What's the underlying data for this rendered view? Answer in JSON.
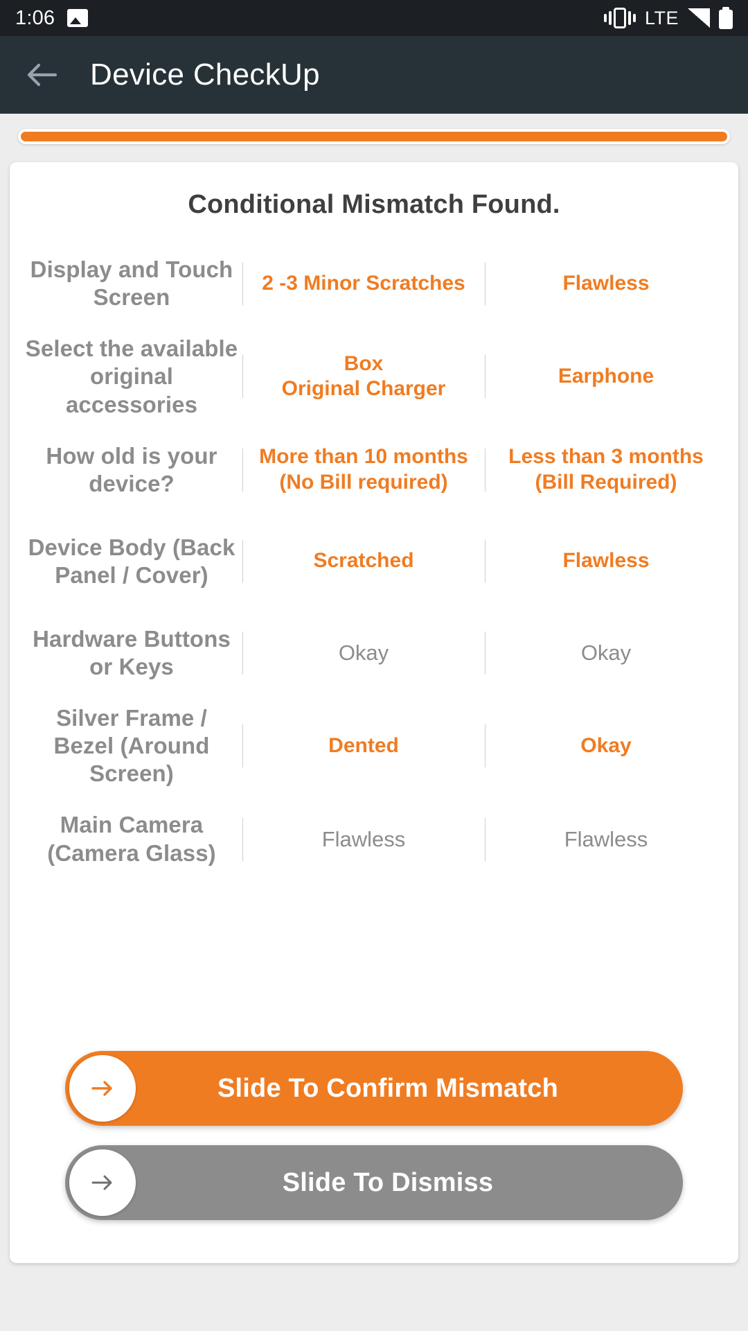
{
  "status_bar": {
    "time": "1:06",
    "network_label": "LTE",
    "icons": [
      "image-icon",
      "vibrate-icon",
      "signal-icon",
      "battery-icon"
    ]
  },
  "app_bar": {
    "back_icon": "back-arrow-icon",
    "title": "Device CheckUp"
  },
  "progress": {
    "percent": 100
  },
  "card": {
    "title": "Conditional Mismatch Found.",
    "colors": {
      "accent": "#f07c22",
      "muted": "#8c8c8c",
      "appbar": "#263238",
      "statusbar": "#1c1f23"
    },
    "rows": [
      {
        "label": "Display and Touch Screen",
        "left_value": "2 -3 Minor Scratches",
        "right_value": "Flawless",
        "mismatch": true
      },
      {
        "label": "Select the available original accessories",
        "left_value": "Box\nOriginal Charger",
        "right_value": "Earphone",
        "mismatch": true
      },
      {
        "label": "How old is your device?",
        "left_value": "More than 10 months (No Bill required)",
        "right_value": "Less than 3 months (Bill Required)",
        "mismatch": true
      },
      {
        "label": "Device Body (Back Panel / Cover)",
        "left_value": "Scratched",
        "right_value": "Flawless",
        "mismatch": true
      },
      {
        "label": "Hardware Buttons or Keys",
        "left_value": "Okay",
        "right_value": "Okay",
        "mismatch": false
      },
      {
        "label": "Silver Frame / Bezel (Around Screen)",
        "left_value": "Dented",
        "right_value": "Okay",
        "mismatch": true
      },
      {
        "label": "Main Camera (Camera Glass)",
        "left_value": "Flawless",
        "right_value": "Flawless",
        "mismatch": false
      }
    ],
    "actions": {
      "confirm_label": "Slide To Confirm Mismatch",
      "dismiss_label": "Slide To Dismiss",
      "knob_icon": "arrow-right-icon"
    }
  }
}
